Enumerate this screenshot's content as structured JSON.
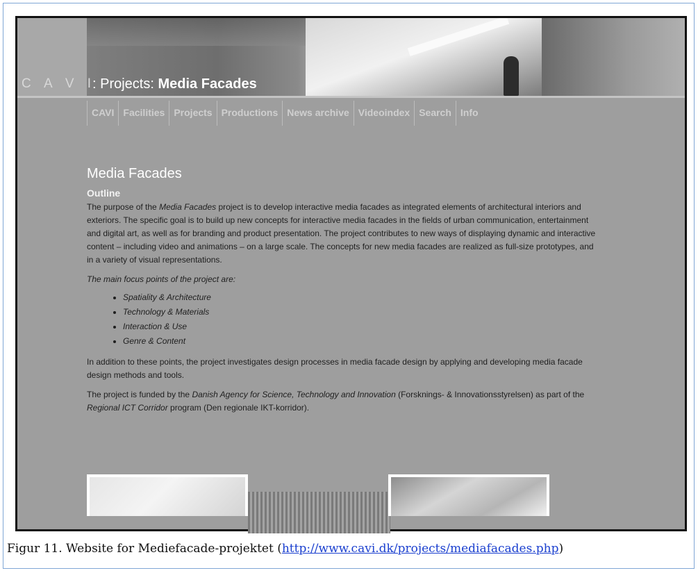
{
  "banner": {
    "logo": "C A V I",
    "breadcrumb_prefix": ": Projects: ",
    "breadcrumb_current": "Media Facades"
  },
  "nav": {
    "items": [
      "CAVI",
      "Facilities",
      "Projects",
      "Productions",
      "News archive",
      "Videoindex",
      "Search",
      "Info"
    ]
  },
  "content": {
    "heading": "Media Facades",
    "outline_heading": "Outline",
    "para1_pre": "The purpose of the ",
    "para1_italic": "Media Facades",
    "para1_post": " project is to develop interactive media facades as integrated elements of architectural interiors and exteriors. The specific goal is to build up new concepts for interactive media facades in the fields of urban communication, entertainment and digital art, as well as for branding and product presentation. The project contributes to new ways of displaying dynamic and interactive content – including video and animations – on a large scale. The concepts for new media facades are realized as full-size prototypes, and in a variety of visual representations.",
    "focus_intro": "The main focus points of the project are:",
    "focus_points": [
      "Spatiality & Architecture",
      "Technology & Materials",
      "Interaction & Use",
      "Genre & Content"
    ],
    "para2": "In addition to these points, the project investigates design processes in media facade design by applying and developing media facade design methods and tools.",
    "para3_pre": "The project is funded by the ",
    "para3_italic1": "Danish Agency for Science, Technology and Innovation",
    "para3_mid": " (Forsknings- & Innovationsstyrelsen) as part of the ",
    "para3_italic2": "Regional ICT Corridor",
    "para3_post": " program (Den regionale IKT-korridor)."
  },
  "caption": {
    "text": "Figur 11. Website for Mediefacade-projektet (",
    "link": "http://www.cavi.dk/projects/mediafacades.php",
    "close": ")"
  }
}
